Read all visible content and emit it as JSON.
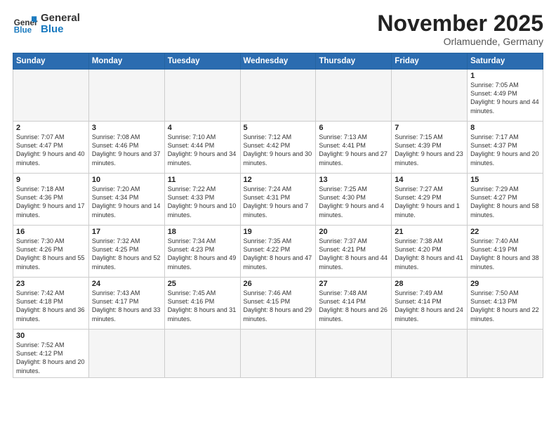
{
  "logo": {
    "general": "General",
    "blue": "Blue"
  },
  "header": {
    "title": "November 2025",
    "subtitle": "Orlamuende, Germany"
  },
  "weekdays": [
    "Sunday",
    "Monday",
    "Tuesday",
    "Wednesday",
    "Thursday",
    "Friday",
    "Saturday"
  ],
  "weeks": [
    [
      {
        "day": "",
        "info": ""
      },
      {
        "day": "",
        "info": ""
      },
      {
        "day": "",
        "info": ""
      },
      {
        "day": "",
        "info": ""
      },
      {
        "day": "",
        "info": ""
      },
      {
        "day": "",
        "info": ""
      },
      {
        "day": "1",
        "info": "Sunrise: 7:05 AM\nSunset: 4:49 PM\nDaylight: 9 hours\nand 44 minutes."
      }
    ],
    [
      {
        "day": "2",
        "info": "Sunrise: 7:07 AM\nSunset: 4:47 PM\nDaylight: 9 hours\nand 40 minutes."
      },
      {
        "day": "3",
        "info": "Sunrise: 7:08 AM\nSunset: 4:46 PM\nDaylight: 9 hours\nand 37 minutes."
      },
      {
        "day": "4",
        "info": "Sunrise: 7:10 AM\nSunset: 4:44 PM\nDaylight: 9 hours\nand 34 minutes."
      },
      {
        "day": "5",
        "info": "Sunrise: 7:12 AM\nSunset: 4:42 PM\nDaylight: 9 hours\nand 30 minutes."
      },
      {
        "day": "6",
        "info": "Sunrise: 7:13 AM\nSunset: 4:41 PM\nDaylight: 9 hours\nand 27 minutes."
      },
      {
        "day": "7",
        "info": "Sunrise: 7:15 AM\nSunset: 4:39 PM\nDaylight: 9 hours\nand 23 minutes."
      },
      {
        "day": "8",
        "info": "Sunrise: 7:17 AM\nSunset: 4:37 PM\nDaylight: 9 hours\nand 20 minutes."
      }
    ],
    [
      {
        "day": "9",
        "info": "Sunrise: 7:18 AM\nSunset: 4:36 PM\nDaylight: 9 hours\nand 17 minutes."
      },
      {
        "day": "10",
        "info": "Sunrise: 7:20 AM\nSunset: 4:34 PM\nDaylight: 9 hours\nand 14 minutes."
      },
      {
        "day": "11",
        "info": "Sunrise: 7:22 AM\nSunset: 4:33 PM\nDaylight: 9 hours\nand 10 minutes."
      },
      {
        "day": "12",
        "info": "Sunrise: 7:24 AM\nSunset: 4:31 PM\nDaylight: 9 hours\nand 7 minutes."
      },
      {
        "day": "13",
        "info": "Sunrise: 7:25 AM\nSunset: 4:30 PM\nDaylight: 9 hours\nand 4 minutes."
      },
      {
        "day": "14",
        "info": "Sunrise: 7:27 AM\nSunset: 4:29 PM\nDaylight: 9 hours\nand 1 minute."
      },
      {
        "day": "15",
        "info": "Sunrise: 7:29 AM\nSunset: 4:27 PM\nDaylight: 8 hours\nand 58 minutes."
      }
    ],
    [
      {
        "day": "16",
        "info": "Sunrise: 7:30 AM\nSunset: 4:26 PM\nDaylight: 8 hours\nand 55 minutes."
      },
      {
        "day": "17",
        "info": "Sunrise: 7:32 AM\nSunset: 4:25 PM\nDaylight: 8 hours\nand 52 minutes."
      },
      {
        "day": "18",
        "info": "Sunrise: 7:34 AM\nSunset: 4:23 PM\nDaylight: 8 hours\nand 49 minutes."
      },
      {
        "day": "19",
        "info": "Sunrise: 7:35 AM\nSunset: 4:22 PM\nDaylight: 8 hours\nand 47 minutes."
      },
      {
        "day": "20",
        "info": "Sunrise: 7:37 AM\nSunset: 4:21 PM\nDaylight: 8 hours\nand 44 minutes."
      },
      {
        "day": "21",
        "info": "Sunrise: 7:38 AM\nSunset: 4:20 PM\nDaylight: 8 hours\nand 41 minutes."
      },
      {
        "day": "22",
        "info": "Sunrise: 7:40 AM\nSunset: 4:19 PM\nDaylight: 8 hours\nand 38 minutes."
      }
    ],
    [
      {
        "day": "23",
        "info": "Sunrise: 7:42 AM\nSunset: 4:18 PM\nDaylight: 8 hours\nand 36 minutes."
      },
      {
        "day": "24",
        "info": "Sunrise: 7:43 AM\nSunset: 4:17 PM\nDaylight: 8 hours\nand 33 minutes."
      },
      {
        "day": "25",
        "info": "Sunrise: 7:45 AM\nSunset: 4:16 PM\nDaylight: 8 hours\nand 31 minutes."
      },
      {
        "day": "26",
        "info": "Sunrise: 7:46 AM\nSunset: 4:15 PM\nDaylight: 8 hours\nand 29 minutes."
      },
      {
        "day": "27",
        "info": "Sunrise: 7:48 AM\nSunset: 4:14 PM\nDaylight: 8 hours\nand 26 minutes."
      },
      {
        "day": "28",
        "info": "Sunrise: 7:49 AM\nSunset: 4:14 PM\nDaylight: 8 hours\nand 24 minutes."
      },
      {
        "day": "29",
        "info": "Sunrise: 7:50 AM\nSunset: 4:13 PM\nDaylight: 8 hours\nand 22 minutes."
      }
    ],
    [
      {
        "day": "30",
        "info": "Sunrise: 7:52 AM\nSunset: 4:12 PM\nDaylight: 8 hours\nand 20 minutes."
      },
      {
        "day": "",
        "info": ""
      },
      {
        "day": "",
        "info": ""
      },
      {
        "day": "",
        "info": ""
      },
      {
        "day": "",
        "info": ""
      },
      {
        "day": "",
        "info": ""
      },
      {
        "day": "",
        "info": ""
      }
    ]
  ]
}
